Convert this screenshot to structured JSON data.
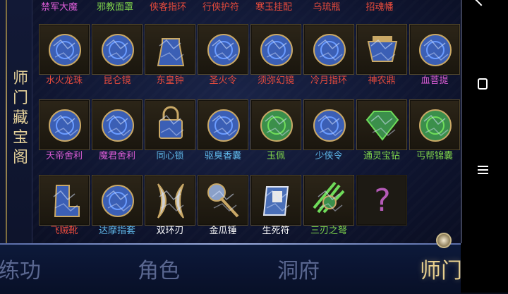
{
  "panel": {
    "title_chars": [
      "师",
      "门",
      "藏",
      "宝",
      "阁"
    ]
  },
  "top_row": [
    {
      "label": "禁军大魔",
      "color": "#d95cd4"
    },
    {
      "label": "邪教面罩",
      "color": "#7fd44b"
    },
    {
      "label": "侠客指环",
      "color": "#e84b3c"
    },
    {
      "label": "行侠护符",
      "color": "#e84b3c"
    },
    {
      "label": "寒玉挂配",
      "color": "#e84b3c"
    },
    {
      "label": "乌琉瓶",
      "color": "#e84b3c"
    },
    {
      "label": "招魂幡",
      "color": "#e84b3c"
    }
  ],
  "grid": [
    [
      {
        "label": "水火龙珠",
        "color": "#e84b3c",
        "icon": "dragon-pearl-icon",
        "tint": "#3b5fb5"
      },
      {
        "label": "昆仑镜",
        "color": "#e84b3c",
        "icon": "kunlun-mirror-icon",
        "tint": "#3b5fb5"
      },
      {
        "label": "东皇钟",
        "color": "#e84b3c",
        "icon": "bell-icon",
        "tint": "#3b5fb5"
      },
      {
        "label": "圣火令",
        "color": "#e84b3c",
        "icon": "holy-fire-token-icon",
        "tint": "#3b5fb5"
      },
      {
        "label": "须弥幻镜",
        "color": "#e84b3c",
        "icon": "illusion-mirror-icon",
        "tint": "#3b5fb5"
      },
      {
        "label": "冷月指环",
        "color": "#e84b3c",
        "icon": "moon-ring-icon",
        "tint": "#3b5fb5"
      },
      {
        "label": "神农鼎",
        "color": "#e84b3c",
        "icon": "cauldron-icon",
        "tint": "#3b5fb5"
      },
      {
        "label": "血菩提",
        "color": "#d95cd4",
        "icon": "blood-bodhi-icon",
        "tint": "#3b5fb5"
      }
    ],
    [
      {
        "label": "天帝舍利",
        "color": "#d95cd4",
        "icon": "relic-orb-icon",
        "tint": "#3b5fb5"
      },
      {
        "label": "魔君舍利",
        "color": "#d95cd4",
        "icon": "demon-relic-icon",
        "tint": "#3b5fb5"
      },
      {
        "label": "同心锁",
        "color": "#5fb7e8",
        "icon": "lock-icon",
        "tint": "#3b5fb5"
      },
      {
        "label": "驱臭香囊",
        "color": "#5fb7e8",
        "icon": "sachet-icon",
        "tint": "#3b5fb5"
      },
      {
        "label": "玉佩",
        "color": "#7fd44b",
        "icon": "jade-pendant-icon",
        "tint": "#3b8f4b"
      },
      {
        "label": "少侠令",
        "color": "#5fb7e8",
        "icon": "hero-token-icon",
        "tint": "#3b5fb5"
      },
      {
        "label": "通灵宝钻",
        "color": "#7fd44b",
        "icon": "diamond-icon",
        "tint": "#3b8f4b"
      },
      {
        "label": "丐帮锦囊",
        "color": "#7fd44b",
        "icon": "pouch-icon",
        "tint": "#3b8f4b"
      }
    ],
    [
      {
        "label": "飞贼靴",
        "color": "#e84b3c",
        "icon": "boot-icon",
        "tint": "#3b5fb5"
      },
      {
        "label": "达摩指套",
        "color": "#5fb7e8",
        "icon": "finger-guard-icon",
        "tint": "#3b5fb5"
      },
      {
        "label": "双环刃",
        "color": "#ffffff",
        "icon": "twin-blades-icon",
        "tint": "#9a9a9a"
      },
      {
        "label": "金瓜锤",
        "color": "#ffffff",
        "icon": "hammer-icon",
        "tint": "#9a9a9a"
      },
      {
        "label": "生死符",
        "color": "#ffffff",
        "icon": "talisman-icon",
        "tint": "#9a9a9a"
      },
      {
        "label": "三刃之弩",
        "color": "#7fd44b",
        "icon": "crossbow-icon",
        "tint": "#3b8f4b"
      },
      {
        "label": "?",
        "color": "#b45ab7",
        "icon": "unknown-icon",
        "tint": "#000000"
      }
    ]
  ],
  "tabs": [
    {
      "label": "练功",
      "active": false
    },
    {
      "label": "角色",
      "active": false
    },
    {
      "label": "洞府",
      "active": false
    },
    {
      "label": "师门",
      "active": true
    }
  ],
  "system_nav": {
    "back": "back-icon",
    "home": "home-icon",
    "menu": "menu-icon"
  }
}
